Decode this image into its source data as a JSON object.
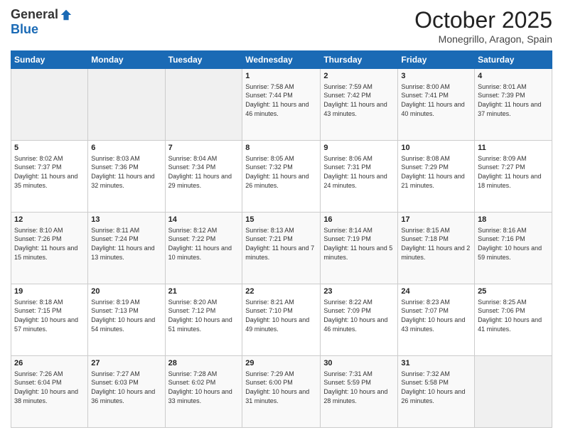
{
  "logo": {
    "general": "General",
    "blue": "Blue"
  },
  "title": "October 2025",
  "subtitle": "Monegrillo, Aragon, Spain",
  "days_of_week": [
    "Sunday",
    "Monday",
    "Tuesday",
    "Wednesday",
    "Thursday",
    "Friday",
    "Saturday"
  ],
  "weeks": [
    [
      {
        "day": "",
        "info": ""
      },
      {
        "day": "",
        "info": ""
      },
      {
        "day": "",
        "info": ""
      },
      {
        "day": "1",
        "info": "Sunrise: 7:58 AM\nSunset: 7:44 PM\nDaylight: 11 hours and 46 minutes."
      },
      {
        "day": "2",
        "info": "Sunrise: 7:59 AM\nSunset: 7:42 PM\nDaylight: 11 hours and 43 minutes."
      },
      {
        "day": "3",
        "info": "Sunrise: 8:00 AM\nSunset: 7:41 PM\nDaylight: 11 hours and 40 minutes."
      },
      {
        "day": "4",
        "info": "Sunrise: 8:01 AM\nSunset: 7:39 PM\nDaylight: 11 hours and 37 minutes."
      }
    ],
    [
      {
        "day": "5",
        "info": "Sunrise: 8:02 AM\nSunset: 7:37 PM\nDaylight: 11 hours and 35 minutes."
      },
      {
        "day": "6",
        "info": "Sunrise: 8:03 AM\nSunset: 7:36 PM\nDaylight: 11 hours and 32 minutes."
      },
      {
        "day": "7",
        "info": "Sunrise: 8:04 AM\nSunset: 7:34 PM\nDaylight: 11 hours and 29 minutes."
      },
      {
        "day": "8",
        "info": "Sunrise: 8:05 AM\nSunset: 7:32 PM\nDaylight: 11 hours and 26 minutes."
      },
      {
        "day": "9",
        "info": "Sunrise: 8:06 AM\nSunset: 7:31 PM\nDaylight: 11 hours and 24 minutes."
      },
      {
        "day": "10",
        "info": "Sunrise: 8:08 AM\nSunset: 7:29 PM\nDaylight: 11 hours and 21 minutes."
      },
      {
        "day": "11",
        "info": "Sunrise: 8:09 AM\nSunset: 7:27 PM\nDaylight: 11 hours and 18 minutes."
      }
    ],
    [
      {
        "day": "12",
        "info": "Sunrise: 8:10 AM\nSunset: 7:26 PM\nDaylight: 11 hours and 15 minutes."
      },
      {
        "day": "13",
        "info": "Sunrise: 8:11 AM\nSunset: 7:24 PM\nDaylight: 11 hours and 13 minutes."
      },
      {
        "day": "14",
        "info": "Sunrise: 8:12 AM\nSunset: 7:22 PM\nDaylight: 11 hours and 10 minutes."
      },
      {
        "day": "15",
        "info": "Sunrise: 8:13 AM\nSunset: 7:21 PM\nDaylight: 11 hours and 7 minutes."
      },
      {
        "day": "16",
        "info": "Sunrise: 8:14 AM\nSunset: 7:19 PM\nDaylight: 11 hours and 5 minutes."
      },
      {
        "day": "17",
        "info": "Sunrise: 8:15 AM\nSunset: 7:18 PM\nDaylight: 11 hours and 2 minutes."
      },
      {
        "day": "18",
        "info": "Sunrise: 8:16 AM\nSunset: 7:16 PM\nDaylight: 10 hours and 59 minutes."
      }
    ],
    [
      {
        "day": "19",
        "info": "Sunrise: 8:18 AM\nSunset: 7:15 PM\nDaylight: 10 hours and 57 minutes."
      },
      {
        "day": "20",
        "info": "Sunrise: 8:19 AM\nSunset: 7:13 PM\nDaylight: 10 hours and 54 minutes."
      },
      {
        "day": "21",
        "info": "Sunrise: 8:20 AM\nSunset: 7:12 PM\nDaylight: 10 hours and 51 minutes."
      },
      {
        "day": "22",
        "info": "Sunrise: 8:21 AM\nSunset: 7:10 PM\nDaylight: 10 hours and 49 minutes."
      },
      {
        "day": "23",
        "info": "Sunrise: 8:22 AM\nSunset: 7:09 PM\nDaylight: 10 hours and 46 minutes."
      },
      {
        "day": "24",
        "info": "Sunrise: 8:23 AM\nSunset: 7:07 PM\nDaylight: 10 hours and 43 minutes."
      },
      {
        "day": "25",
        "info": "Sunrise: 8:25 AM\nSunset: 7:06 PM\nDaylight: 10 hours and 41 minutes."
      }
    ],
    [
      {
        "day": "26",
        "info": "Sunrise: 7:26 AM\nSunset: 6:04 PM\nDaylight: 10 hours and 38 minutes."
      },
      {
        "day": "27",
        "info": "Sunrise: 7:27 AM\nSunset: 6:03 PM\nDaylight: 10 hours and 36 minutes."
      },
      {
        "day": "28",
        "info": "Sunrise: 7:28 AM\nSunset: 6:02 PM\nDaylight: 10 hours and 33 minutes."
      },
      {
        "day": "29",
        "info": "Sunrise: 7:29 AM\nSunset: 6:00 PM\nDaylight: 10 hours and 31 minutes."
      },
      {
        "day": "30",
        "info": "Sunrise: 7:31 AM\nSunset: 5:59 PM\nDaylight: 10 hours and 28 minutes."
      },
      {
        "day": "31",
        "info": "Sunrise: 7:32 AM\nSunset: 5:58 PM\nDaylight: 10 hours and 26 minutes."
      },
      {
        "day": "",
        "info": ""
      }
    ]
  ]
}
